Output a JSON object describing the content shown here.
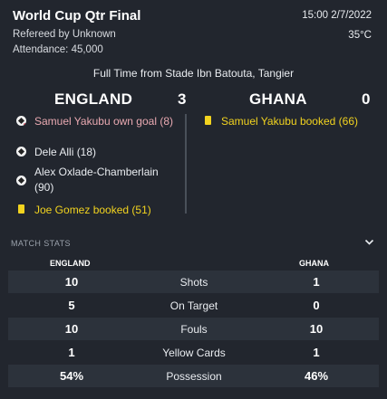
{
  "match": {
    "title": "World Cup Qtr Final",
    "referee": "Refereed by Unknown",
    "attendance": "Attendance: 45,000",
    "datetime": "15:00 2/7/2022",
    "temperature": "35°C",
    "result_line": "Full Time from Stade Ibn Batouta, Tangier"
  },
  "home": {
    "name": "ENGLAND",
    "score": "3",
    "events": [
      {
        "icon": "own-goal-ball-icon",
        "text": "Samuel Yakubu own goal (8)",
        "color": "#e9a9b1"
      },
      {
        "icon": "football-icon",
        "text": "Dele Alli (18)",
        "color": "#e9ecf0"
      },
      {
        "icon": "football-icon",
        "text": "Alex Oxlade-Chamberlain (90)",
        "color": "#e9ecf0"
      },
      {
        "icon": "yellow-card-icon",
        "text": "Joe Gomez booked (51)",
        "color": "#f2d31f"
      }
    ]
  },
  "away": {
    "name": "GHANA",
    "score": "0",
    "events": [
      {
        "icon": "yellow-card-icon",
        "text": "Samuel Yakubu booked (66)",
        "color": "#f2d31f"
      }
    ]
  },
  "stats": {
    "header": "MATCH STATS",
    "home_label": "ENGLAND",
    "away_label": "GHANA",
    "rows": [
      {
        "label": "Shots",
        "home": "10",
        "away": "1"
      },
      {
        "label": "On Target",
        "home": "5",
        "away": "0"
      },
      {
        "label": "Fouls",
        "home": "10",
        "away": "10"
      },
      {
        "label": "Yellow Cards",
        "home": "1",
        "away": "1"
      },
      {
        "label": "Possession",
        "home": "54%",
        "away": "46%"
      }
    ]
  },
  "colors": {
    "background": "#22262e",
    "row_stripe": "#2c323b",
    "yellow_card": "#f2d31f",
    "own_goal_text": "#e9a9b1"
  }
}
